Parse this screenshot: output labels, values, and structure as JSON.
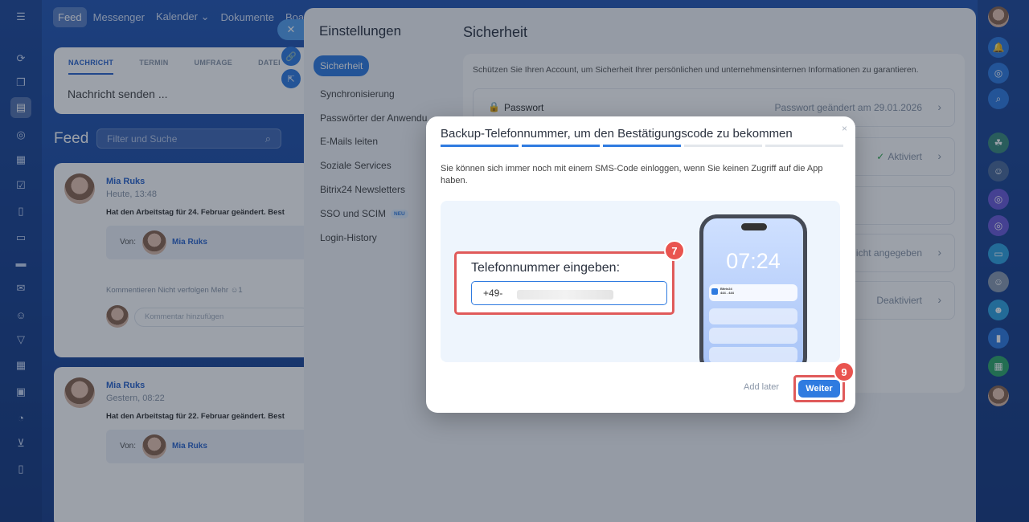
{
  "top_nav": {
    "items": [
      "Feed",
      "Messenger",
      "Kalender ⌄",
      "Dokumente",
      "Boar"
    ]
  },
  "composer": {
    "tabs": [
      "NACHRICHT",
      "TERMIN",
      "UMFRAGE",
      "DATEI"
    ],
    "placeholder": "Nachricht senden ..."
  },
  "feed": {
    "title": "Feed",
    "search_placeholder": "Filter und Suche"
  },
  "posts": [
    {
      "author": "Mia Ruks",
      "date": "Heute, 13:48",
      "text": "Hat den Arbeitstag für 24. Februar geändert. Best",
      "von_label": "Von:",
      "von_name": "Mia Ruks",
      "actions": "Kommentieren   Nicht verfolgen   Mehr   ☺1",
      "comment_placeholder": "Kommentar hinzufügen"
    },
    {
      "author": "Mia Ruks",
      "date": "Gestern, 08:22",
      "text": "Hat den Arbeitstag für 22. Februar geändert. Best",
      "von_label": "Von:",
      "von_name": "Mia Ruks"
    }
  ],
  "settings": {
    "title": "Einstellungen",
    "nav": [
      "Sicherheit",
      "Synchronisierung",
      "Passwörter der Anwendu...",
      "E-Mails leiten",
      "Soziale Services",
      "Bitrix24 Newsletters",
      "SSO und SCIM",
      "Login-History"
    ],
    "neu_badge": "NEU",
    "content_title": "Sicherheit",
    "description": "Schützen Sie Ihren Account, um Sicherheit Ihrer persönlichen und unternehmensinternen Informationen zu garantieren.",
    "rows": [
      {
        "label": "Passwort",
        "value": "Passwort geändert am 29.01.2026"
      },
      {
        "label": "",
        "value": "Aktiviert"
      },
      {
        "label": "",
        "value": ""
      },
      {
        "label": "",
        "value": "Nicht angegeben"
      },
      {
        "label": "",
        "value": "Deaktiviert"
      }
    ]
  },
  "modal": {
    "title": "Backup-Telefonnummer, um den Bestätigungscode zu bekommen",
    "description": "Sie können sich immer noch mit einem SMS-Code einloggen, wenn Sie keinen Zugriff auf die App haben.",
    "phone_label": "Telefonnummer eingeben:",
    "phone_value": "+49-",
    "phone_clock": "07:24",
    "notif_title": "Bitrix24",
    "notif_code": "444 - 444",
    "step7": "7",
    "step9": "9",
    "add_later": "Add later",
    "next_button": "Weiter",
    "close_glyph": "×"
  },
  "colors": {
    "accent": "#2f7be0",
    "highlight": "#e05a5a",
    "background": "#2557b3"
  }
}
